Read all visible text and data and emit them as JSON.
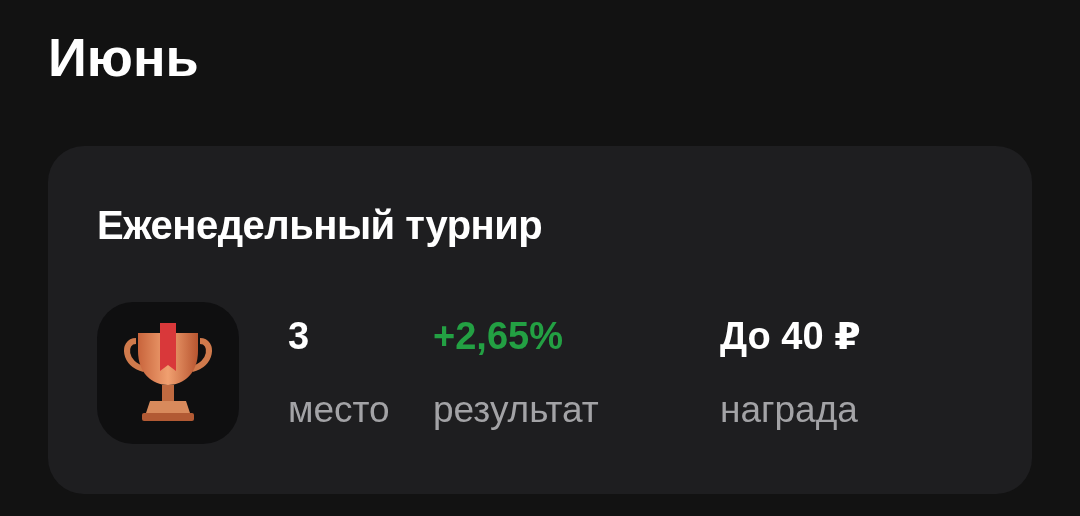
{
  "heading": "Июнь",
  "tournament": {
    "title": "Еженедельный турнир",
    "stats": [
      {
        "value": "3",
        "label": "место",
        "color": "#ffffff"
      },
      {
        "value": "+2,65%",
        "label": "результат",
        "color": "#23a043"
      },
      {
        "value": "До 40 ₽",
        "label": "награда",
        "color": "#ffffff"
      }
    ]
  }
}
